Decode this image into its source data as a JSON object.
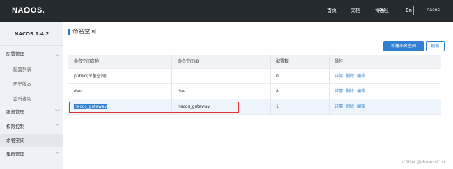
{
  "header": {
    "logo": "NACOS.",
    "nav": [
      "首页",
      "文档",
      "博客",
      "社区"
    ],
    "lang": "En",
    "user": "nacos"
  },
  "sidebar": {
    "version": "NACOS 1.4.2",
    "items": [
      {
        "label": "配置管理",
        "type": "group"
      },
      {
        "label": "配置列表",
        "type": "sub"
      },
      {
        "label": "历史版本",
        "type": "sub"
      },
      {
        "label": "监听查询",
        "type": "sub"
      },
      {
        "label": "服务管理",
        "type": "group"
      },
      {
        "label": "权限控制",
        "type": "group"
      },
      {
        "label": "命名空间",
        "type": "item"
      },
      {
        "label": "集群管理",
        "type": "group"
      }
    ]
  },
  "page": {
    "title": "命名空间",
    "new_button": "新建命名空间",
    "refresh_button": "刷新"
  },
  "table": {
    "headers": [
      "命名空间名称",
      "命名空间ID",
      "配置数",
      "操作"
    ],
    "rows": [
      {
        "name": "public(保留空间)",
        "id": "",
        "count": "0"
      },
      {
        "name": "dev",
        "id": "dev",
        "count": "8"
      },
      {
        "name": "nacos_gateway",
        "id": "nacos_gateway",
        "count": "1"
      }
    ],
    "actions": [
      "详情",
      "删除",
      "编辑"
    ]
  },
  "watermark": "CSDN @dream21st",
  "colors": {
    "topbar": "#252a2f",
    "accent": "#2f80d1",
    "highlight_box": "#e03131"
  }
}
